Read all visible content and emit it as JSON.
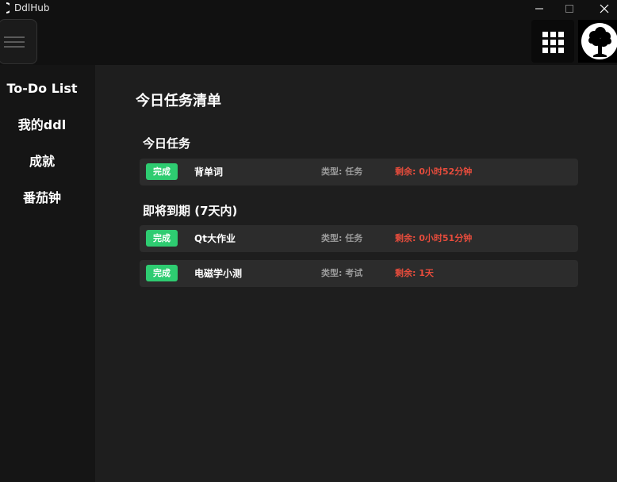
{
  "window": {
    "title": "DdlHub",
    "controls": {
      "minimize": "—",
      "maximize": "□",
      "close": "✕"
    }
  },
  "header": {
    "menu_icon": "hamburger-menu-icon",
    "apps_icon": "grid-apps-icon",
    "avatar_icon": "tree-avatar-icon"
  },
  "sidebar": {
    "items": [
      {
        "label": "To-Do List"
      },
      {
        "label": "我的ddl"
      },
      {
        "label": "成就"
      },
      {
        "label": "番茄钟"
      }
    ]
  },
  "main": {
    "title": "今日任务清单",
    "sections": [
      {
        "title": "今日任务",
        "tasks": [
          {
            "done_label": "完成",
            "name": "背单词",
            "type": "类型: 任务",
            "remaining": "剩余: 0小时52分钟"
          }
        ]
      },
      {
        "title": "即将到期 (7天内)",
        "tasks": [
          {
            "done_label": "完成",
            "name": "Qt大作业",
            "type": "类型: 任务",
            "remaining": "剩余: 0小时51分钟"
          },
          {
            "done_label": "完成",
            "name": "电磁学小测",
            "type": "类型: 考试",
            "remaining": "剩余: 1天"
          }
        ]
      }
    ]
  },
  "colors": {
    "done_button": "#2ecc71",
    "remaining_text": "#e74c3c",
    "row_background": "#2c2c2c",
    "sidebar_background": "#151515",
    "main_background": "#1e1e1e"
  }
}
